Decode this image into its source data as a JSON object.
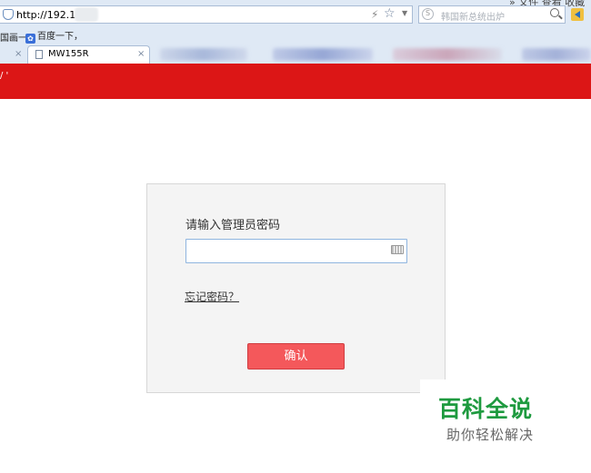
{
  "browser": {
    "menu_label": "» 文件 查看 收藏",
    "address": "http://192.168",
    "search_placeholder": "韩国新总统出炉",
    "search_engine_icon": "S",
    "bookmarks": [
      {
        "label": "国画一"
      },
      {
        "label": "百度一下，"
      }
    ],
    "active_tab": {
      "title": "MW155R"
    },
    "tab_close_glyph": "×"
  },
  "router": {
    "brand_color": "#dc1616",
    "logo_mark": "/ '"
  },
  "login": {
    "prompt": "请输入管理员密码",
    "password_value": "",
    "forgot_link": "忘记密码？",
    "confirm_label": "确认"
  },
  "watermark": {
    "title": "百科全说",
    "subtitle": "助你轻松解决"
  },
  "colors": {
    "confirm_button": "#f4585b",
    "watermark_green": "#1e9a3f"
  }
}
